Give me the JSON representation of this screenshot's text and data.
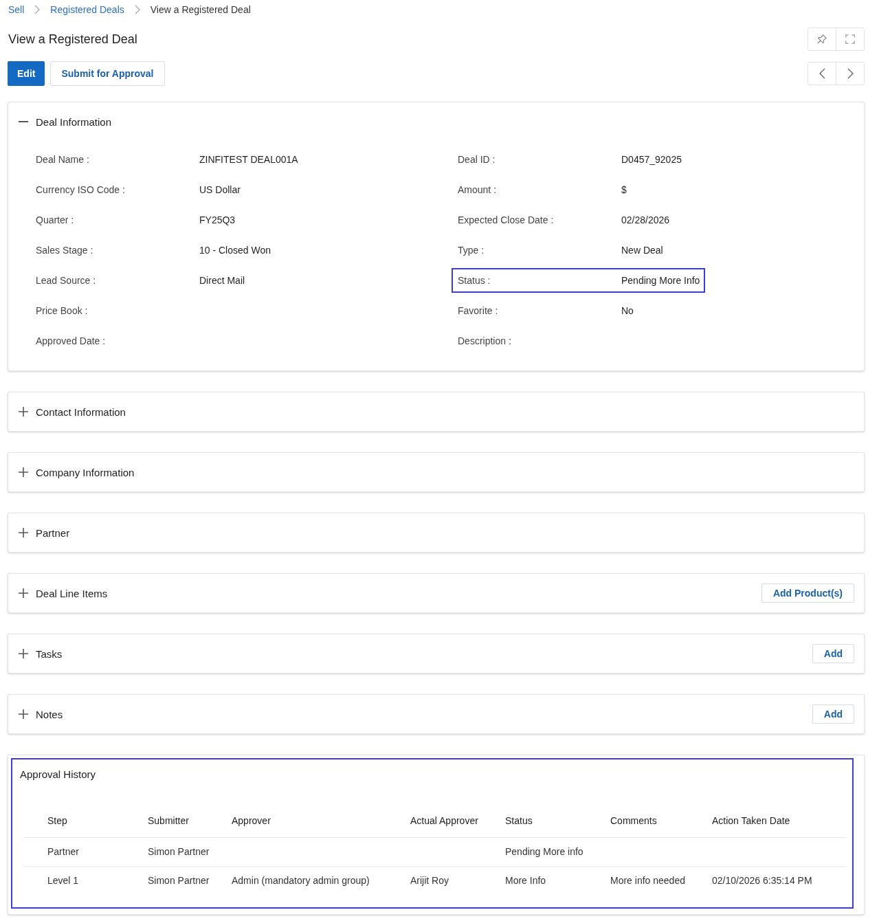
{
  "breadcrumb": [
    {
      "label": "Sell",
      "kind": "link"
    },
    {
      "label": "Registered Deals",
      "kind": "link"
    },
    {
      "label": "View a Registered Deal",
      "kind": "current"
    }
  ],
  "header": {
    "title": "View a Registered Deal"
  },
  "actions": [
    {
      "label": "Edit",
      "kind": "primary"
    },
    {
      "label": "Submit for Approval",
      "kind": "secondary"
    }
  ],
  "sections": [
    {
      "title": "Deal Information",
      "expanded": true,
      "fields": [
        {
          "label": "Deal Name :",
          "value": "ZINFITEST DEAL001A",
          "highlighted": false
        },
        {
          "label": "Deal ID :",
          "value": "D0457_92025",
          "highlighted": false
        },
        {
          "label": "Currency ISO Code :",
          "value": "US Dollar",
          "highlighted": false
        },
        {
          "label": "Amount :",
          "value": "$",
          "highlighted": false
        },
        {
          "label": "Quarter :",
          "value": "FY25Q3",
          "highlighted": false
        },
        {
          "label": "Expected Close Date :",
          "value": "02/28/2026",
          "highlighted": false
        },
        {
          "label": "Sales Stage :",
          "value": "10 - Closed Won",
          "highlighted": false
        },
        {
          "label": "Type :",
          "value": "New Deal",
          "highlighted": false
        },
        {
          "label": "Lead Source :",
          "value": "Direct Mail",
          "highlighted": false
        },
        {
          "label": "Status :",
          "value": "Pending More Info",
          "highlighted": true
        },
        {
          "label": "Price Book :",
          "highlighted": false
        },
        {
          "label": "Favorite :",
          "value": "No",
          "highlighted": false
        },
        {
          "label": "Approved Date :",
          "highlighted": false
        },
        {
          "label": "Description :",
          "highlighted": false
        }
      ]
    },
    {
      "title": "Contact Information",
      "expanded": false
    },
    {
      "title": "Company Information",
      "expanded": false
    },
    {
      "title": "Partner",
      "expanded": false
    },
    {
      "title": "Deal Line Items",
      "expanded": false,
      "action": "Add Product(s)"
    },
    {
      "title": "Tasks",
      "expanded": false,
      "action": "Add"
    },
    {
      "title": "Notes",
      "expanded": false,
      "action": "Add"
    }
  ],
  "approval_history": {
    "title": "Approval History",
    "highlighted": true,
    "columns": [
      "Step",
      "Submitter",
      "Approver",
      "Actual Approver",
      "Status",
      "Comments",
      "Action Taken Date"
    ],
    "rows": [
      {
        "step": "Partner",
        "submitter": "Simon Partner",
        "status": "Pending More info"
      },
      {
        "step": "Level 1",
        "submitter": "Simon Partner",
        "approver": "Admin (mandatory admin group)",
        "actual_approver": "Arijit Roy",
        "status": "More Info",
        "comments": "More info needed",
        "action_taken_date": "02/10/2026 6:35:14 PM"
      }
    ]
  }
}
